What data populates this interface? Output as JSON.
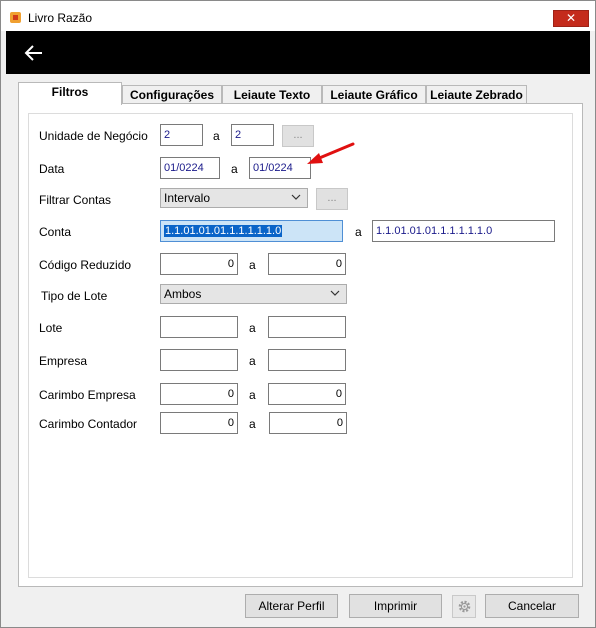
{
  "window": {
    "title": "Livro Razão",
    "close_glyph": "✕"
  },
  "tabs": [
    {
      "label": "Filtros"
    },
    {
      "label": "Configurações"
    },
    {
      "label": "Leiaute Texto"
    },
    {
      "label": "Leiaute Gráfico"
    },
    {
      "label": "Leiaute Zebrado"
    }
  ],
  "form": {
    "unidade": {
      "label": "Unidade de Negócio",
      "from": "2",
      "sep": "a",
      "to": "2",
      "button": "..."
    },
    "data": {
      "label": "Data",
      "from": "01/0224",
      "sep": "a",
      "to": "01/0224"
    },
    "filtrar_contas": {
      "label": "Filtrar Contas",
      "value": "Intervalo",
      "button": "..."
    },
    "conta": {
      "label": "Conta",
      "from": "1.1.01.01.01.1.1.1.1.1.0",
      "sep": "a",
      "to": "1.1.01.01.01.1.1.1.1.1.0"
    },
    "codigo_reduzido": {
      "label": "Código Reduzido",
      "from": "0",
      "sep": "a",
      "to": "0"
    },
    "tipo_lote": {
      "label": "Tipo de Lote",
      "value": "Ambos"
    },
    "lote": {
      "label": "Lote",
      "from": "",
      "sep": "a",
      "to": ""
    },
    "empresa": {
      "label": "Empresa",
      "from": "",
      "sep": "a",
      "to": ""
    },
    "carimbo_empresa": {
      "label": "Carimbo Empresa",
      "from": "0",
      "sep": "a",
      "to": "0"
    },
    "carimbo_contador": {
      "label": "Carimbo Contador",
      "from": "0",
      "sep": "a",
      "to": "0"
    }
  },
  "buttons": {
    "alterar_perfil": "Alterar Perfil",
    "imprimir": "Imprimir",
    "cancelar": "Cancelar"
  },
  "icons": {
    "back": "arrow-left-icon",
    "settings": "gear-icon",
    "annotation": "red-arrow-annotation"
  },
  "colors": {
    "close_button": "#c42b1c",
    "header_bar": "#000000",
    "field_text": "#1a1a8a",
    "selection": "#0a64c8",
    "annotation_arrow": "#e01010"
  }
}
